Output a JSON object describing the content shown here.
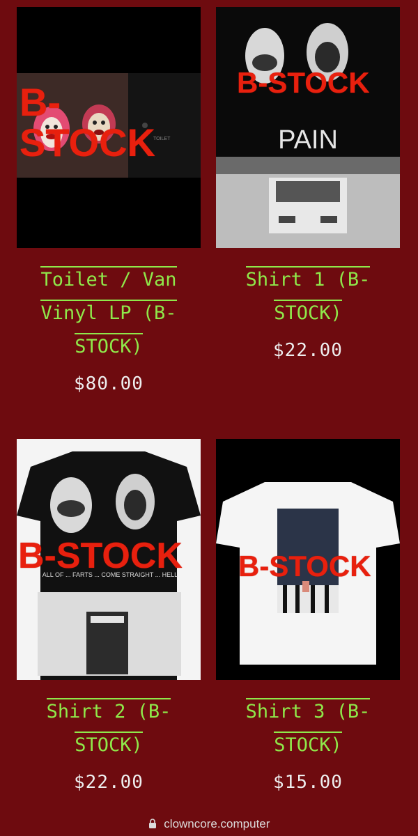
{
  "products": [
    {
      "title_lines": [
        "Toilet / Van",
        "Vinyl LP (B-",
        "STOCK)"
      ],
      "price": "$80.00",
      "overlay": "B-STOCK",
      "overlay_lines": [
        "B-",
        "STOCK"
      ]
    },
    {
      "title_lines": [
        "Shirt 1 (B-",
        "STOCK)"
      ],
      "price": "$22.00",
      "overlay": "B-STOCK",
      "shirt_text": "PAIN"
    },
    {
      "title_lines": [
        "Shirt 2 (B-",
        "STOCK)"
      ],
      "price": "$22.00",
      "overlay": "B-STOCK",
      "shirt_text": "ALL OF ... FARTS ... COME STRAIGHT ... HELL"
    },
    {
      "title_lines": [
        "Shirt 3 (B-",
        "STOCK)"
      ],
      "price": "$15.00",
      "overlay": "B-STOCK"
    }
  ],
  "vinyl_label": "TOILET",
  "browser": {
    "url": "clowncore.computer",
    "icon": "lock-icon"
  },
  "colors": {
    "background": "#6e0b0f",
    "title": "#8fe84a",
    "price": "#eeeeee",
    "overlay": "#e8200e"
  }
}
